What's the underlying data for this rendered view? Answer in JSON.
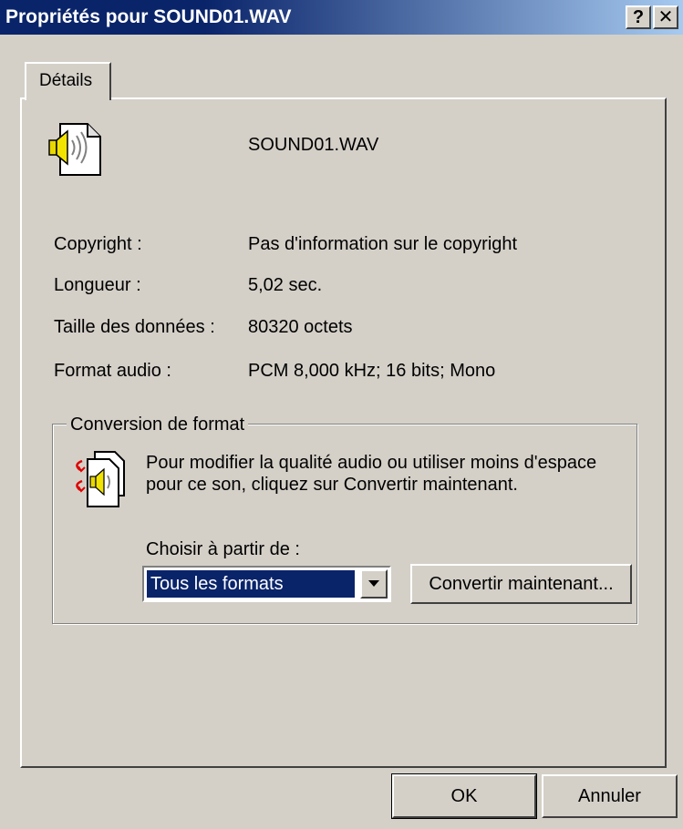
{
  "window": {
    "title": "Propriétés pour SOUND01.WAV",
    "help_label": "?",
    "close_label": "✕"
  },
  "tabs": [
    {
      "label": "Détails",
      "active": true
    }
  ],
  "file": {
    "icon": "wav-sound-file-icon",
    "name": "SOUND01.WAV"
  },
  "details": [
    {
      "label": "Copyright :",
      "value": "Pas d'information sur le copyright"
    },
    {
      "label": "Longueur :",
      "value": "5,02 sec."
    },
    {
      "label": "Taille des données :",
      "value": "80320 octets"
    },
    {
      "label": "Format audio :",
      "value": "PCM 8,000 kHz; 16 bits; Mono"
    }
  ],
  "conversion": {
    "legend": "Conversion de format",
    "icon": "convert-sound-icon",
    "description": "Pour modifier la qualité audio ou utiliser moins d'espace pour ce son, cliquez sur Convertir maintenant.",
    "choose_label": "Choisir à partir de :",
    "select_value": "Tous les formats",
    "convert_button": "Convertir maintenant..."
  },
  "buttons": {
    "ok": "OK",
    "cancel": "Annuler"
  },
  "colors": {
    "titlebar_start": "#0a246a",
    "titlebar_end": "#a6caf0",
    "face": "#d4d0c8",
    "selection": "#0a246a"
  }
}
